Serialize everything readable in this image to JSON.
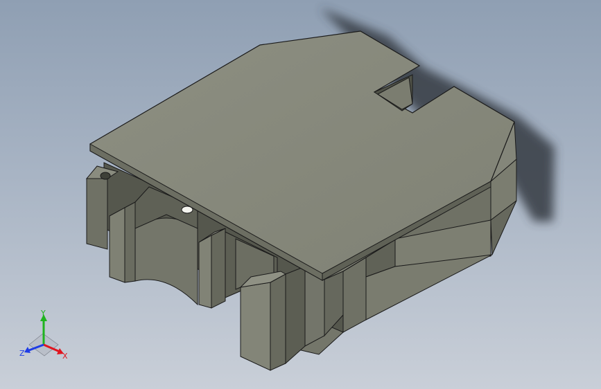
{
  "app": {
    "background_top": "#8f9fb3",
    "background_bottom": "#c9cfd8"
  },
  "model": {
    "body_color": "#7d7f71",
    "top_color": "#8a8c7e",
    "dark_color": "#4e5046",
    "edge_color": "#1a1a1a",
    "shadow_color": "#353a42"
  },
  "triad": {
    "x_label": "X",
    "y_label": "Y",
    "z_label": "Z",
    "x_color": "#e0141e",
    "y_color": "#1fb41f",
    "z_color": "#1e3ce6"
  }
}
